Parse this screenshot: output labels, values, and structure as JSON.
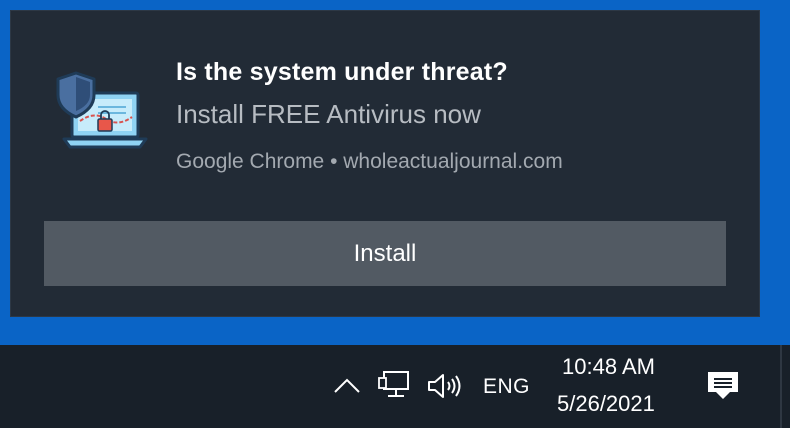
{
  "notification": {
    "title": "Is the system under threat?",
    "body": "Install FREE Antivirus now",
    "source": "Google Chrome • wholeactualjournal.com",
    "button_label": "Install",
    "icon": "shield-laptop-lock-icon"
  },
  "taskbar": {
    "language": "ENG",
    "time": "10:48 AM",
    "date": "5/26/2021",
    "icons": [
      "chevron-up-icon",
      "network-icon",
      "volume-icon",
      "action-center-icon"
    ]
  },
  "colors": {
    "desktop_blue": "#0a64c6",
    "toast_bg": "#222b36",
    "button_bg": "#525a63",
    "taskbar_bg": "#182029"
  }
}
